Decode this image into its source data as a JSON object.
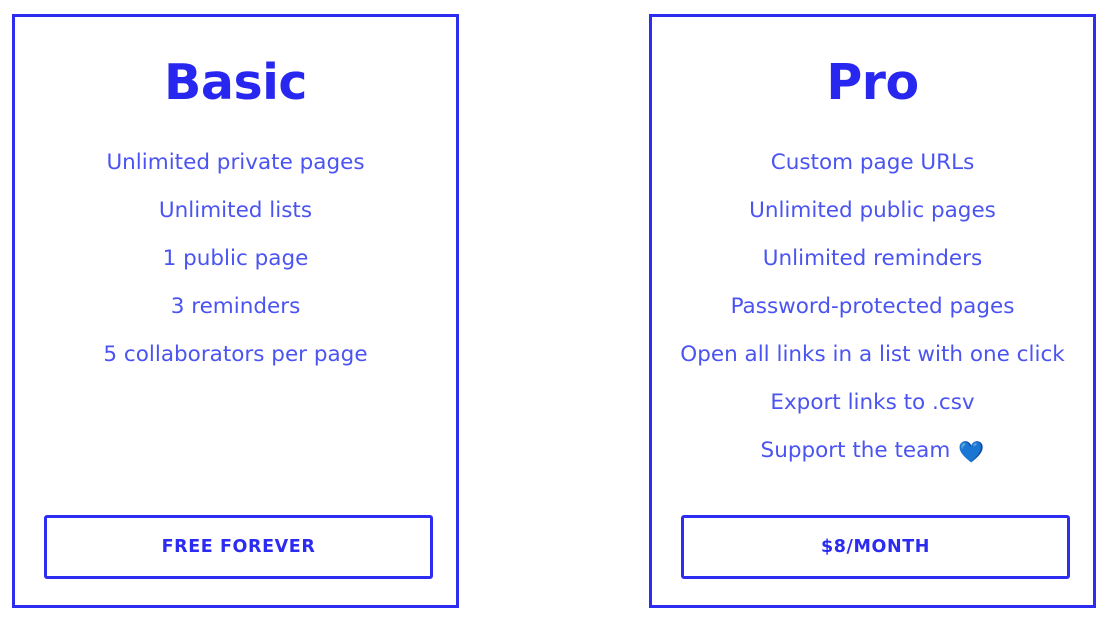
{
  "page": {
    "background_color": "#ffffff",
    "accent_color": "#2d2df2",
    "title_color": "#2727f0",
    "feature_color": "#4b54f0",
    "heart_color": "#1f8fe0"
  },
  "plans": [
    {
      "id": "basic",
      "title": "Basic",
      "features": [
        {
          "text": "Unlimited private pages",
          "icon": null
        },
        {
          "text": "Unlimited lists",
          "icon": null
        },
        {
          "text": "1 public page",
          "icon": null
        },
        {
          "text": "3 reminders",
          "icon": null
        },
        {
          "text": "5 collaborators per page",
          "icon": null
        }
      ],
      "cta_label": "FREE FOREVER"
    },
    {
      "id": "pro",
      "title": "Pro",
      "features": [
        {
          "text": "Custom page URLs",
          "icon": null
        },
        {
          "text": "Unlimited public pages",
          "icon": null
        },
        {
          "text": "Unlimited reminders",
          "icon": null
        },
        {
          "text": "Password-protected pages",
          "icon": null
        },
        {
          "text": "Open all links in a list with one click",
          "icon": null
        },
        {
          "text": "Export links to .csv",
          "icon": null
        },
        {
          "text": "Support the team",
          "icon": "blue-heart-icon",
          "icon_glyph": "💙"
        }
      ],
      "cta_label": "$8/MONTH"
    }
  ]
}
